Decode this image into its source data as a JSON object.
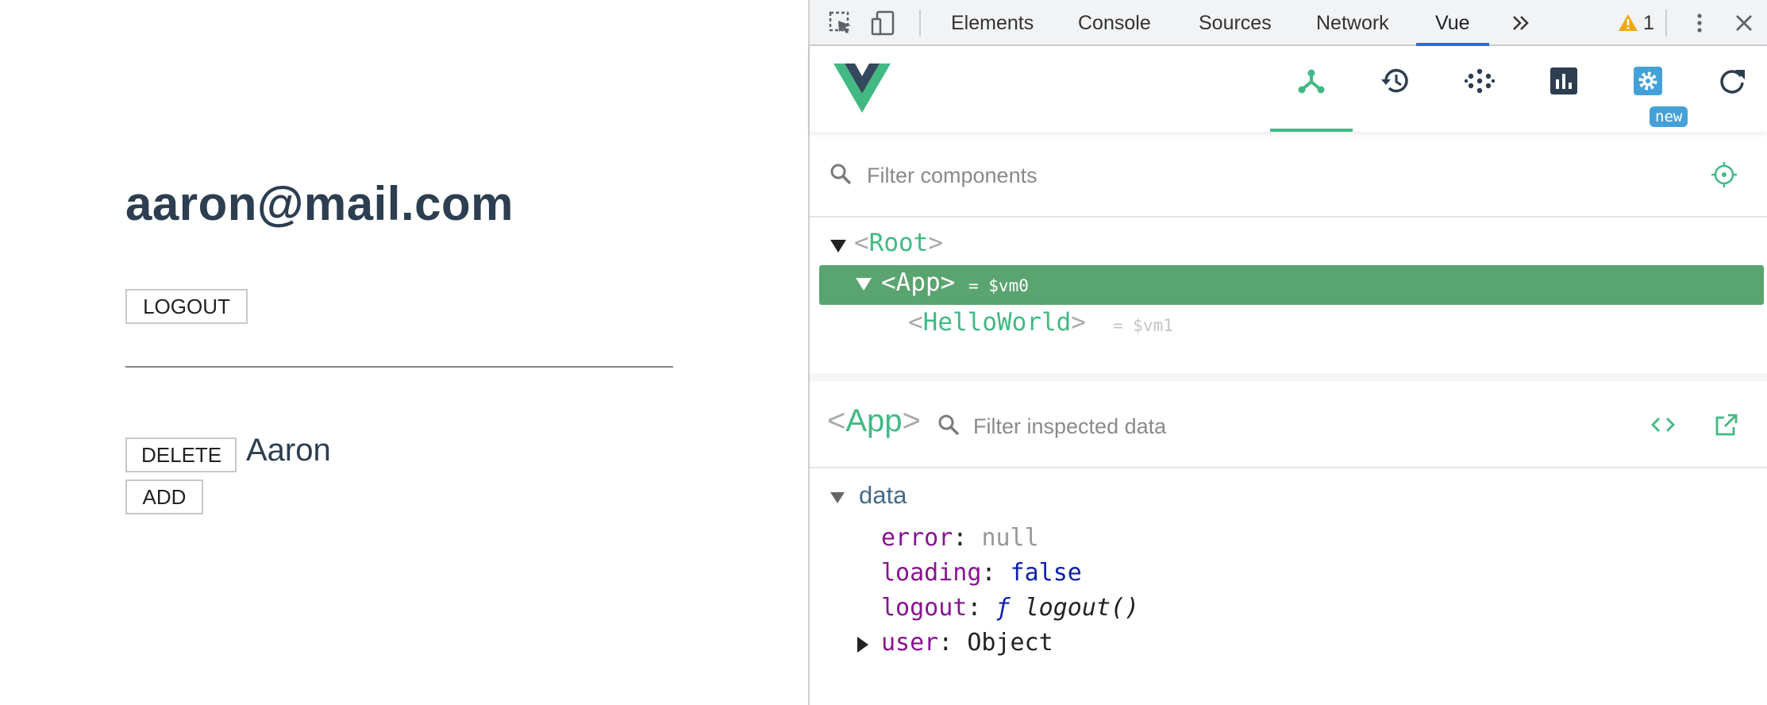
{
  "app": {
    "email": "aaron@mail.com",
    "logout_label": "LOGOUT",
    "delete_label": "DELETE",
    "user_name": "Aaron",
    "add_label": "ADD"
  },
  "devtools": {
    "tabs": [
      "Elements",
      "Console",
      "Sources",
      "Network",
      "Vue"
    ],
    "active_tab": "Vue",
    "more_tabs_icon": "chevron-double-right-icon",
    "warning_count": "1",
    "vue": {
      "toolbar_icons": [
        "components-icon",
        "history-icon",
        "vuex-icon",
        "performance-icon",
        "settings-icon",
        "refresh-icon"
      ],
      "new_badge": "new",
      "filter_components_placeholder": "Filter components",
      "tree": [
        {
          "name": "Root",
          "vm": ""
        },
        {
          "name": "App",
          "vm": "= $vm0",
          "selected": true
        },
        {
          "name": "HelloWorld",
          "vm": "= $vm1"
        }
      ],
      "inspected_component": "App",
      "filter_data_placeholder": "Filter inspected data",
      "data_section": "data",
      "props": [
        {
          "key": "error",
          "value": "null"
        },
        {
          "key": "loading",
          "value": "false"
        },
        {
          "key": "logout",
          "value_prefix": "ƒ",
          "value": "logout()"
        },
        {
          "key": "user",
          "value": "Object"
        }
      ]
    }
  },
  "colors": {
    "vue_green": "#42b983",
    "selected_row": "#5aa470",
    "devtools_blue": "#1a73e8",
    "text_dark": "#2c3e50"
  }
}
